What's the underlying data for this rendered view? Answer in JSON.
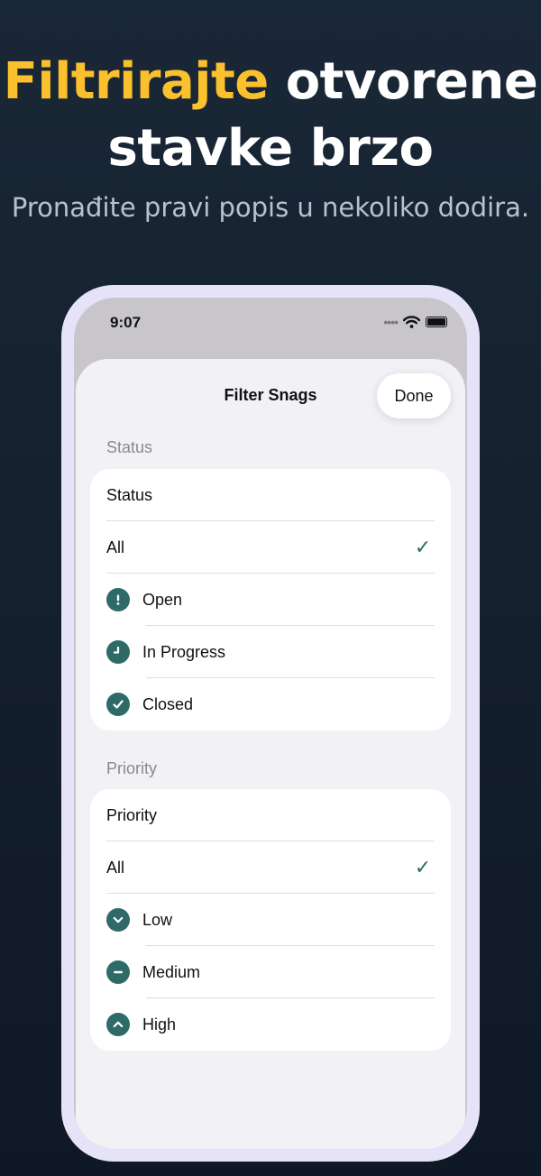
{
  "promo": {
    "headline_highlight": "Filtrirajte",
    "headline_rest_line1": " otvorene",
    "headline_line2": "stavke brzo",
    "subtitle": "Pronađite pravi popis u nekoliko dodira."
  },
  "status_bar": {
    "time": "9:07"
  },
  "sheet": {
    "title": "Filter Snags",
    "done_label": "Done"
  },
  "status_section": {
    "header": "Status",
    "card_title": "Status",
    "options": [
      {
        "label": "All",
        "icon": "none",
        "selected": true
      },
      {
        "label": "Open",
        "icon": "exclamation-circle-icon",
        "selected": false
      },
      {
        "label": "In Progress",
        "icon": "clock-icon",
        "selected": false
      },
      {
        "label": "Closed",
        "icon": "checkmark-circle-icon",
        "selected": false
      }
    ]
  },
  "priority_section": {
    "header": "Priority",
    "card_title": "Priority",
    "options": [
      {
        "label": "All",
        "icon": "none",
        "selected": true
      },
      {
        "label": "Low",
        "icon": "chevron-down-circle-icon",
        "selected": false
      },
      {
        "label": "Medium",
        "icon": "minus-circle-icon",
        "selected": false
      },
      {
        "label": "High",
        "icon": "chevron-up-circle-icon",
        "selected": false
      }
    ]
  },
  "colors": {
    "accent_yellow": "#fbc02d",
    "accent_teal": "#2e6b68",
    "background": "#1a2736"
  }
}
